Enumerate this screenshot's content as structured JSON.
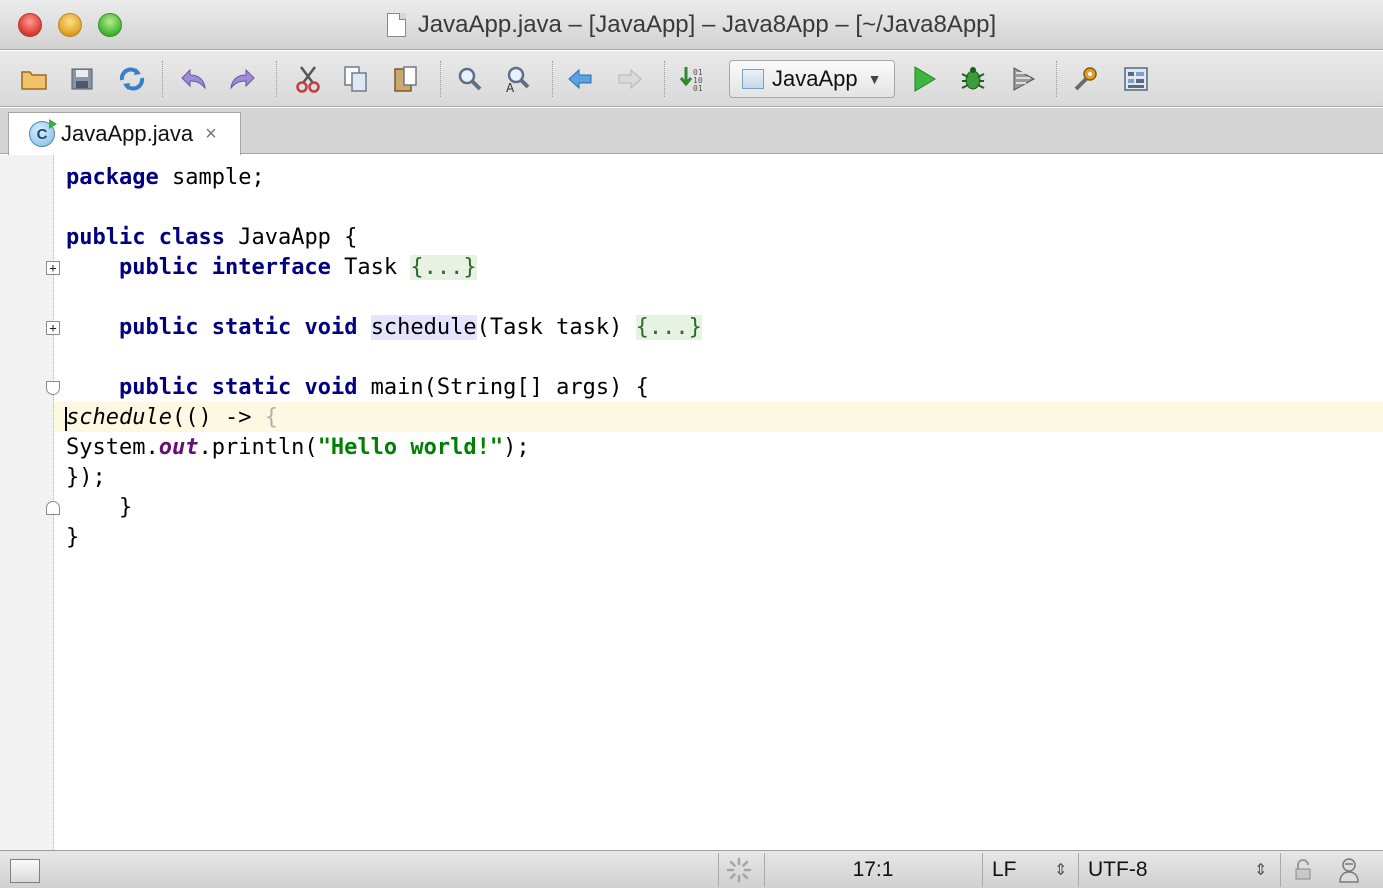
{
  "window": {
    "title": "JavaApp.java – [JavaApp] – Java8App – [~/Java8App]"
  },
  "toolbar": {
    "run_config_label": "JavaApp",
    "icons": [
      "open-folder-icon",
      "save-all-icon",
      "synchronize-icon",
      "undo-icon",
      "redo-icon",
      "cut-icon",
      "copy-icon",
      "paste-icon",
      "find-icon",
      "replace-icon",
      "back-icon",
      "forward-icon",
      "make-project-icon",
      "run-icon",
      "debug-icon",
      "run-with-coverage-icon",
      "project-structure-icon",
      "settings-icon"
    ]
  },
  "tab": {
    "icon_letter": "C",
    "label": "JavaApp.java",
    "close_glyph": "×"
  },
  "code": {
    "l1_kw": "package",
    "l1_rest": " sample;",
    "l3_kw1": "public",
    "l3_kw2": "class",
    "l3_rest": " JavaApp {",
    "l4_kw1": "public",
    "l4_kw2": "interface",
    "l4_name": " Task ",
    "l4_folded": "{...}",
    "l6_kw1": "public",
    "l6_kw2": "static",
    "l6_kw3": "void",
    "l6_method": "schedule",
    "l6_rest": "(Task task) ",
    "l6_folded": "{...}",
    "l8_kw1": "public",
    "l8_kw2": "static",
    "l8_kw3": "void",
    "l8_rest": " main(String[] args) {",
    "l9_call": "schedule",
    "l9_rest": "(() -> ",
    "l9_brace": "{",
    "l10_a": "System.",
    "l10_field": "out",
    "l10_b": ".println(",
    "l10_str": "\"Hello world!\"",
    "l10_c": ");",
    "l11": "});",
    "l12": "    }",
    "l13": "}"
  },
  "status": {
    "position": "17:1",
    "line_separator": "LF",
    "encoding": "UTF-8",
    "updown_glyph": "⇕"
  }
}
